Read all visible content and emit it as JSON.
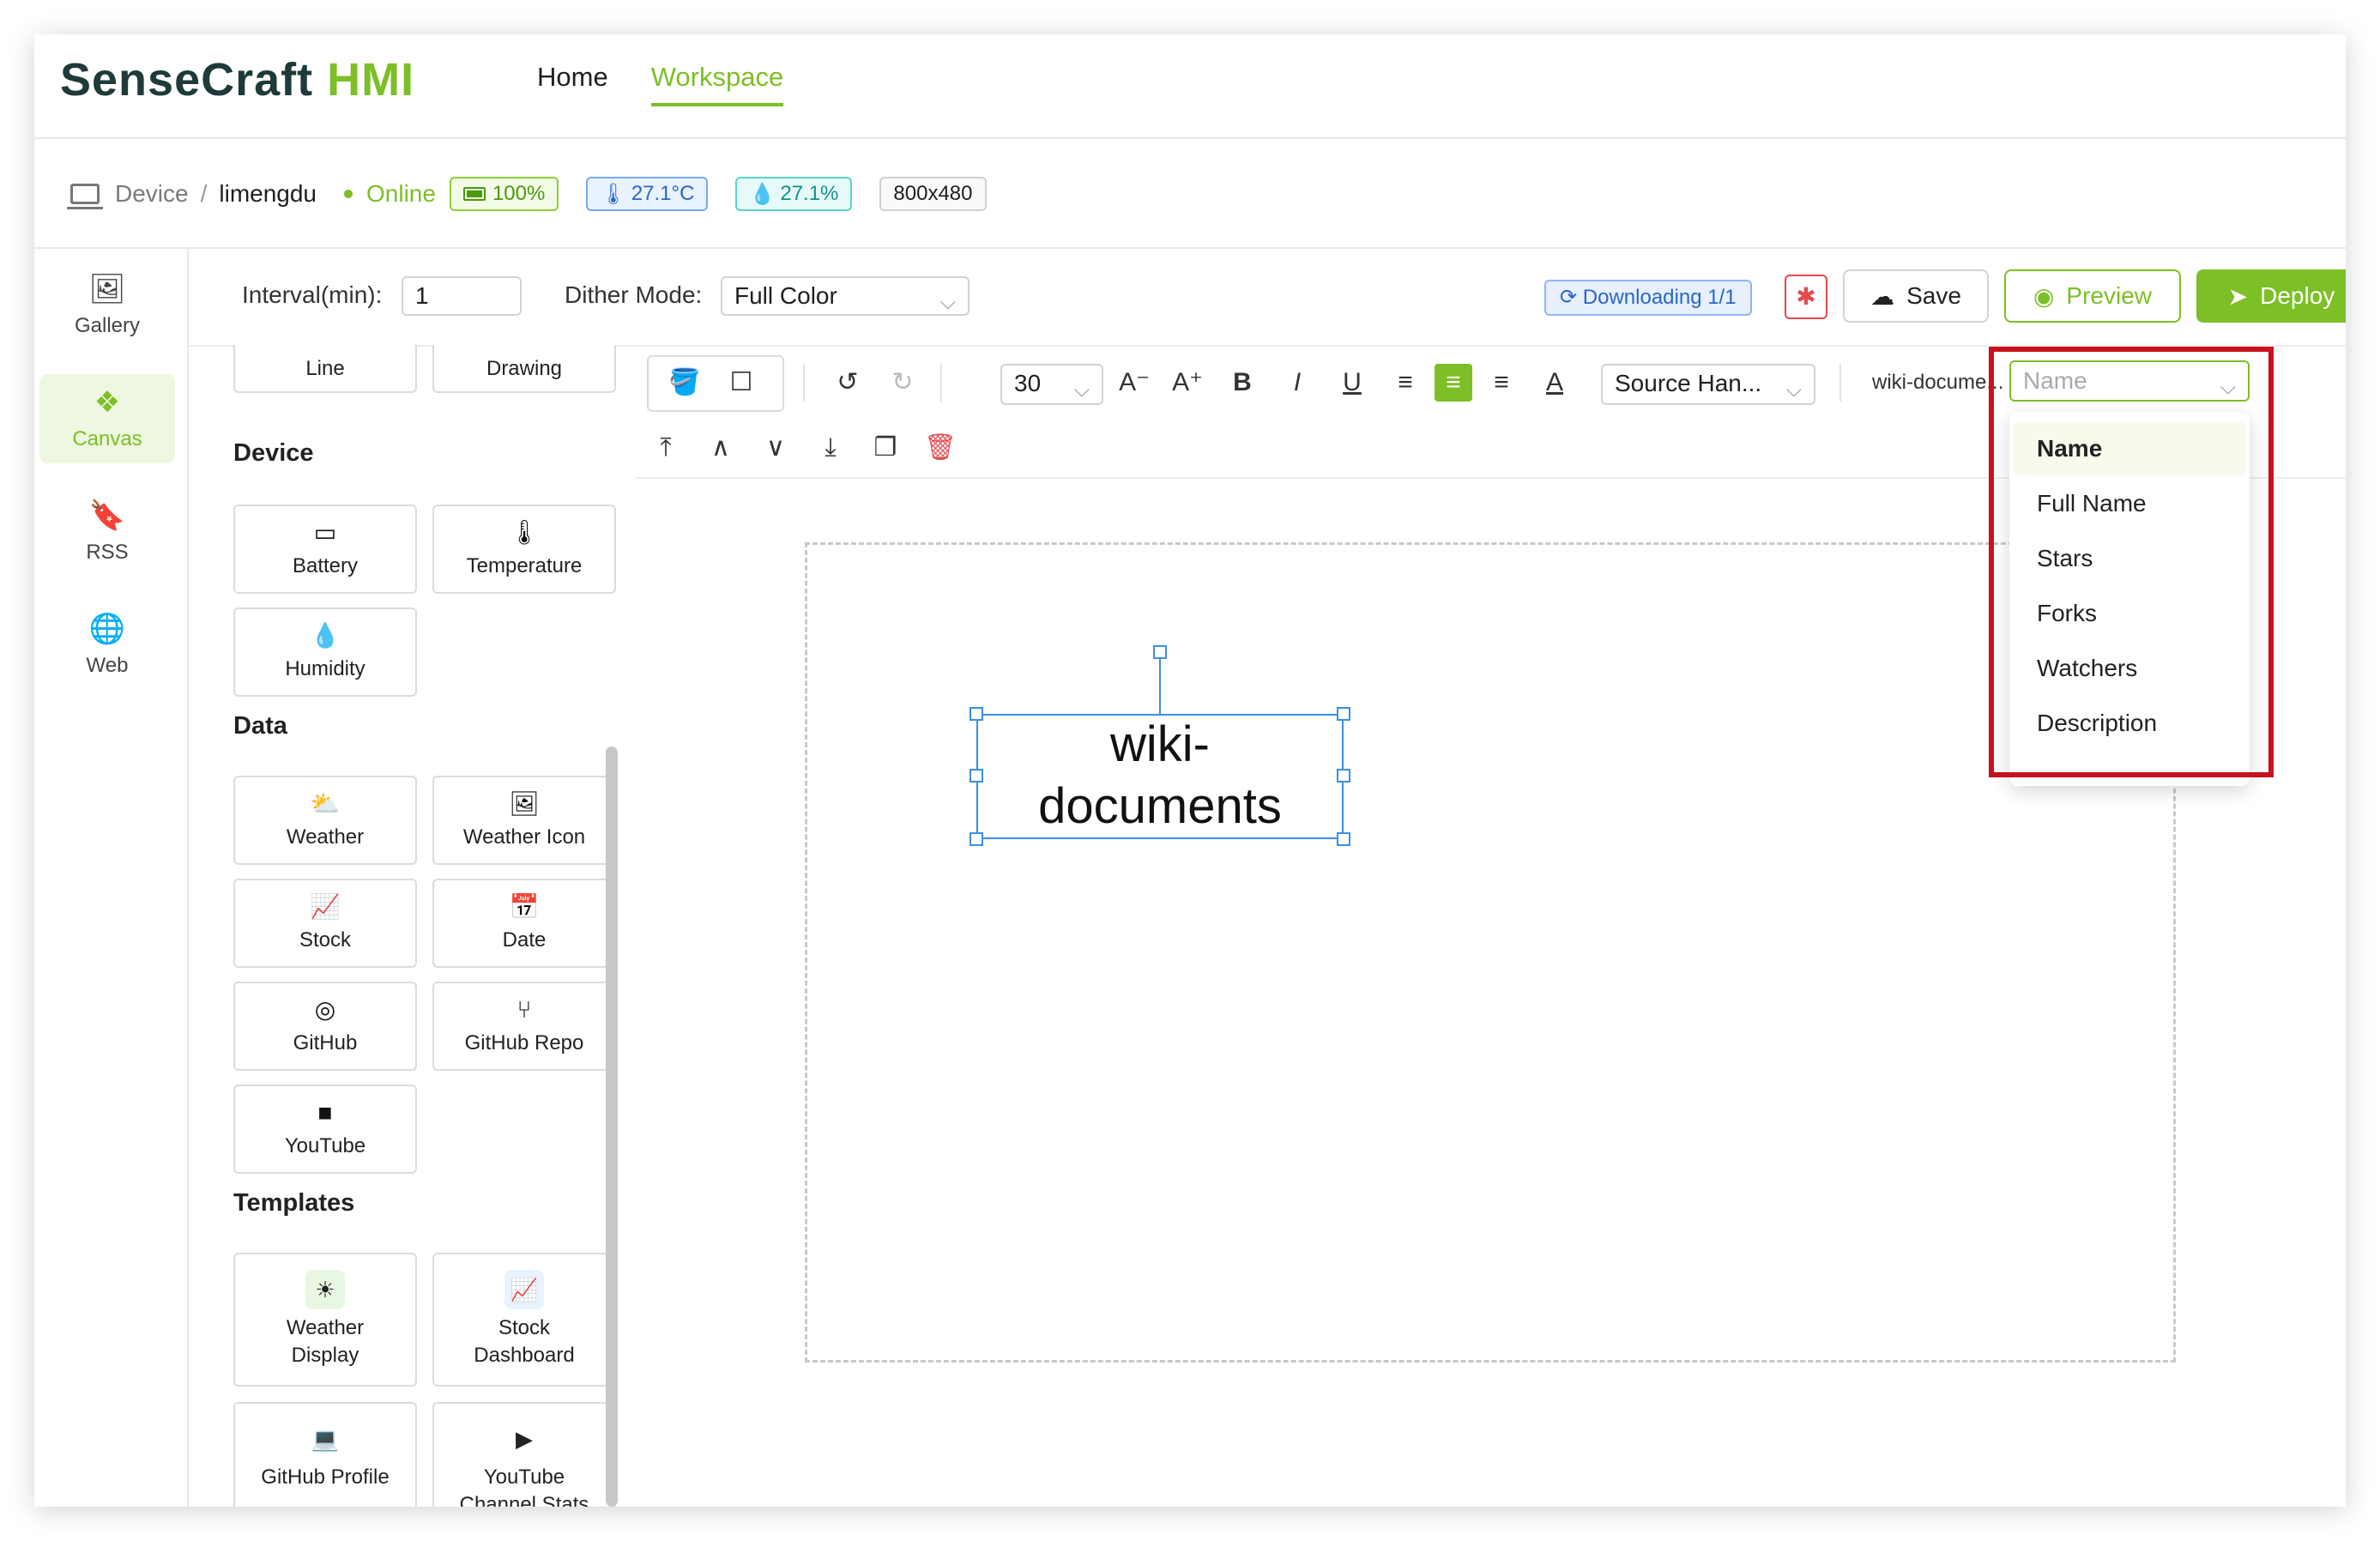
{
  "header": {
    "logo_part1": "SenseCraft",
    "logo_part2": "HMI",
    "nav": [
      {
        "label": "Home",
        "active": false
      },
      {
        "label": "Workspace",
        "active": true
      }
    ]
  },
  "device": {
    "crumb_root": "Device",
    "crumb_sep": "/",
    "name": "limengdu",
    "status": "Online",
    "battery": "100%",
    "temperature": "27.1°C",
    "humidity": "27.1%",
    "resolution": "800x480"
  },
  "rail": [
    {
      "label": "Gallery",
      "icon": "image-icon",
      "active": false
    },
    {
      "label": "Canvas",
      "icon": "canvas-icon",
      "active": true
    },
    {
      "label": "RSS",
      "icon": "bookmark-plus-icon",
      "active": false
    },
    {
      "label": "Web",
      "icon": "globe-icon",
      "active": false
    }
  ],
  "toolbar": {
    "interval_label": "Interval(min):",
    "interval_value": "1",
    "dither_label": "Dither Mode:",
    "dither_value": "Full Color",
    "downloading": "Downloading 1/1",
    "save": "Save",
    "preview": "Preview",
    "deploy": "Deploy"
  },
  "widgets": {
    "basic": [
      "Line",
      "Drawing"
    ],
    "device_title": "Device",
    "device": [
      "Battery",
      "Temperature",
      "Humidity"
    ],
    "data_title": "Data",
    "data": [
      "Weather",
      "Weather Icon",
      "Stock",
      "Date",
      "GitHub",
      "GitHub Repo",
      "YouTube"
    ],
    "templates_title": "Templates",
    "templates": [
      "Weather\nDisplay",
      "Stock\nDashboard",
      "GitHub Profile",
      "YouTube\nChannel Stats"
    ]
  },
  "editor": {
    "font_size": "30",
    "font_family": "Source Han...",
    "text_value": "wiki-docume...",
    "field_placeholder": "Name"
  },
  "canvas": {
    "text_line1": "wiki-",
    "text_line2": "documents"
  },
  "dropdown": {
    "options": [
      "Name",
      "Full Name",
      "Stars",
      "Forks",
      "Watchers",
      "Description"
    ],
    "selected": "Name"
  },
  "colors": {
    "accent": "#7cbf26",
    "highlight": "#c9101e",
    "selection": "#3a8ee6"
  }
}
